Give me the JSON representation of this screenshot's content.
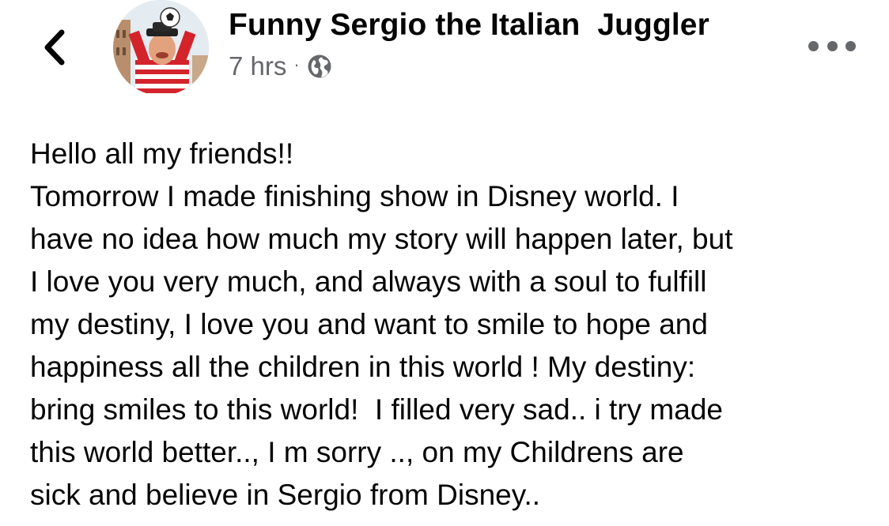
{
  "post": {
    "author_name": "Funny Sergio the Italian  Juggler",
    "timestamp": "7 hrs",
    "separator": "·",
    "privacy_icon": "globe-icon",
    "more_icon": "more-options-icon",
    "back_icon": "back-chevron-icon",
    "body_lines": [
      "Hello all my friends!!",
      "Tomorrow I made finishing show in Disney world. I",
      "have no idea how much my story will happen later, but",
      "I love you very much, and always with a soul to fulfill",
      "my destiny, I love you and want to smile to hope and",
      "happiness all the children in this world ! My destiny:",
      "bring smiles to this world!  I filled very sad.. i try made",
      "this world better.., I m sorry .., on my Childrens are",
      "sick and believe in Sergio from Disney.."
    ]
  },
  "colors": {
    "text_primary": "#050505",
    "text_secondary": "#65676b",
    "background": "#ffffff"
  }
}
